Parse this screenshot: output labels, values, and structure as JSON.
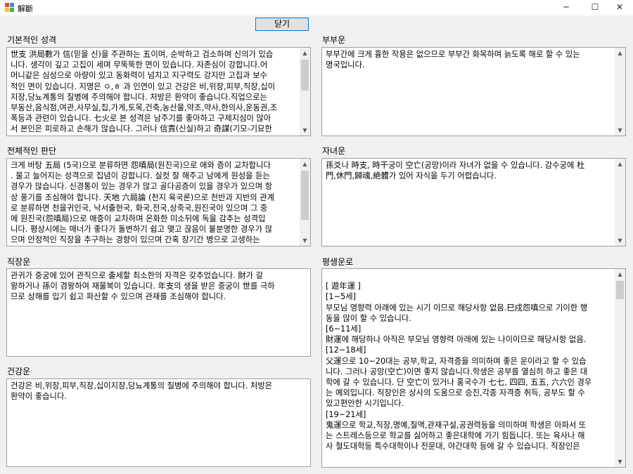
{
  "window": {
    "title": "解斷",
    "minimize_glyph": "─",
    "maximize_glyph": "☐",
    "close_glyph": "✕"
  },
  "toolbar": {
    "close_label": "닫기"
  },
  "sections": {
    "basic": {
      "label": "기본적인 성격",
      "lines": [
        "世支 洪局數가 信(믿을 신)을 주관하는 五이며, 순박하고 검소하며 신의가 있습",
        "니다. 생각이 깊고 고집이 세며 무뚝뚝한 면이 있습니다. 자존심이 강합니다.어",
        "머니같은 심성으로 아량이 있고 동화력이 넘치고 지구력도 강지만 고집과 보수",
        "적인 면이 있습니다. 지명은 ㅇ,ㅎ 과 인연이 있고 건강은 비,위장,피부,직장,십이",
        "지장,당뇨계통의 질병에 주의해야 합니다. 처방은 환약이 좋습니다.직업으로는",
        "부동산,음식점,여관,사무실,집,가게,토목,건축,농산물,약조,약사,한의사,운동권,조",
        "폭등과 관련이 있습니다. 七火로 본 성격은 남주기를 좋아하고 구제지심이 많아",
        "서 본인은 피로하고 손해가 많습니다. 그러나 信責(신실)하고 奇謀(기모-기묘한"
      ]
    },
    "overall": {
      "label": "전체적인 판단",
      "lines": [
        " 크게 바탕 五局 (5국)으로 분류하면   怨嗔局(원진국)으로 애와 증이 교차합니다",
        ". 물고 늘어지는 성격으로 집념이 강합니다. 실컷 잘 해주고 남에게 원성을 듣는",
        "경우가 많습니다. 신경통이 있는 경우가 많고 골다공증이 있을 경우가 있으며 항",
        "상 풍기를 조심해야 합니다. 天地 六局論 (천지 육국론)으로 천반과 지반의 관계",
        "로 분류하면  천을귀인국, 낙서출현국, 화국,전국,상죽국,원진국이 있으며 그 중",
        "에  원진국(怨嗔局)으로 애증이 교차하며 온화한 미소뒤에 독을 감추는 성격입",
        "니다. 평상시에는 매너가 좋다가 돌변하기 쉽고 맺고 끊음이 불분명한 경우가 많",
        "으며   안정적인 직장을 추구하는 경향이 있으며 간혹 장기간 병으로 고생하는"
      ]
    },
    "career": {
      "label": "직장운",
      "lines": [
        " 관귀가 중궁에 있어 관직으로 출세할 최소한의 자격은 갖추었습니다.   財가 갈",
        "왕하거나 孫이 겸왕하여 재물복이 있습니다. 年支의 생을 받은 중궁이 世를 극하",
        "므로 상해를 입기 쉽고 파산할 수 있으며 관재를 조심해야 합니다."
      ]
    },
    "health": {
      "label": "건강운",
      "lines": [
        " 건강은 비,위장,피부,직장,십이지장,당뇨계통의 질병에 주의해야 합니다. 처방은",
        "환약이 좋습니다."
      ]
    },
    "spouse": {
      "label": "부부운",
      "lines": [
        "  부부간에 크게 흉한 작용은 없으므로 부부간 화목하며 늙도록 해로 할 수 있는",
        "명국입니다."
      ]
    },
    "children": {
      "label": "자녀운",
      "lines": [
        " 孫爻나 時支, 時干궁이 空亡(공망)이라 자녀가 없을 수 있습니다.  감수궁에 杜",
        "門,休門,歸魂,絶體가 있어 자식을 두기 어렵습니다."
      ]
    },
    "lifetime": {
      "label": "평생운로",
      "lines": [
        "",
        "[ 遊年運 ]",
        "[1~5세]",
        " 부모님 영향력 아래에 있는 시기 이므로 해당사항 없음.巳戌怨嗔으로 기이한 행",
        "동을 많이 할 수 있습니다.",
        "[6~11세]",
        " 財運에 해당하나 아직은 부모님 영향력 아래에 있는 나이이므로 해당사항 없음.",
        "[12~18세]",
        " 父運으로 10~20대는 공부,학교, 자격증을 의미하며 좋은 운이라고 할 수 있습",
        "니다. 그러나 공망(空亡)이면 좋지 않습니다.학생은 공부를 열심히 하고 좋은 대",
        "학에 갈 수 있습니다. 단 空亡이 있거나 홍국수가 七七, 四四, 五五, 六六인 경우",
        "는 예외입니다. 직장인은 상사의 도움으로 승진,각종 자격증 취득, 공부도 할 수",
        "있고편안한 시기입니다.",
        "[19~21세]",
        " 鬼運으로 학교,직장,명예,질액,관재구설,공권력등을 의미하며 학생은 아파서 또",
        "는 스트레스등으로 학교를 싫어하고 좋은대학에 가기 힘듭니다. 또는 육사나 해",
        "사 철도대학등 특수대학이나 전문대, 야간대학 등에 갈 수 있습니다. 직장인은"
      ]
    }
  },
  "icons": {
    "scroll_up": "▲",
    "scroll_down": "▼"
  }
}
